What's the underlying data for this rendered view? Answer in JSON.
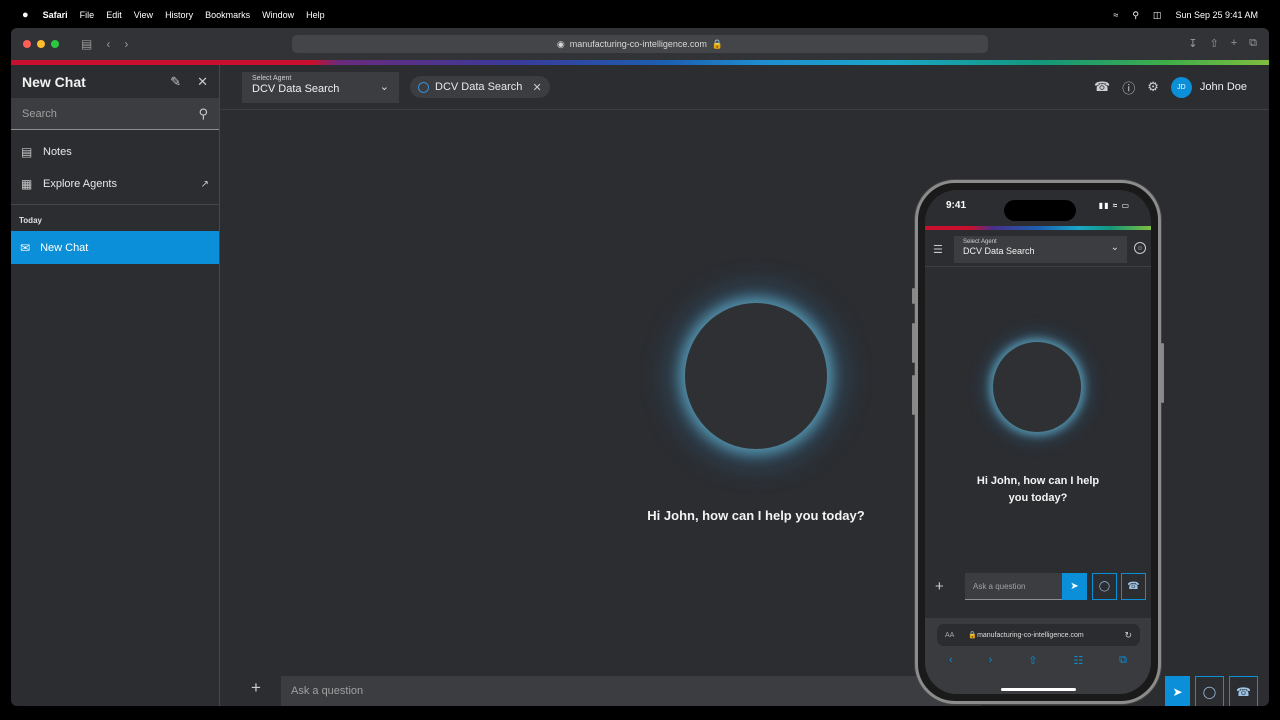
{
  "menubar": {
    "apple": "",
    "items": [
      "Safari",
      "File",
      "Edit",
      "View",
      "History",
      "Bookmarks",
      "Window",
      "Help"
    ],
    "datetime": "Sun Sep 25  9:41 AM"
  },
  "browser": {
    "url": "manufacturing-co-intelligence.com"
  },
  "sidebar": {
    "title": "New Chat",
    "search_placeholder": "Search",
    "items": [
      {
        "label": "Notes"
      },
      {
        "label": "Explore Agents"
      }
    ],
    "section": "Today",
    "active_chat": "New Chat"
  },
  "header": {
    "select_label": "Select Agent",
    "select_value": "DCV Data Search",
    "chip_label": "DCV Data Search",
    "avatar_initials": "JD",
    "user_name": "John Doe"
  },
  "main": {
    "greeting": "Hi John, how can I help you today?",
    "ask_placeholder": "Ask a question"
  },
  "phone": {
    "time": "9:41",
    "select_label": "Select Agent",
    "select_value": "DCV Data Search",
    "greeting": "Hi John, how can I help you today?",
    "ask_placeholder": "Ask a question",
    "url_aa": "AA",
    "url": "manufacturing-co-intelligence.com"
  },
  "colors": {
    "accent": "#0a8fd8",
    "background": "#2b2d31"
  }
}
